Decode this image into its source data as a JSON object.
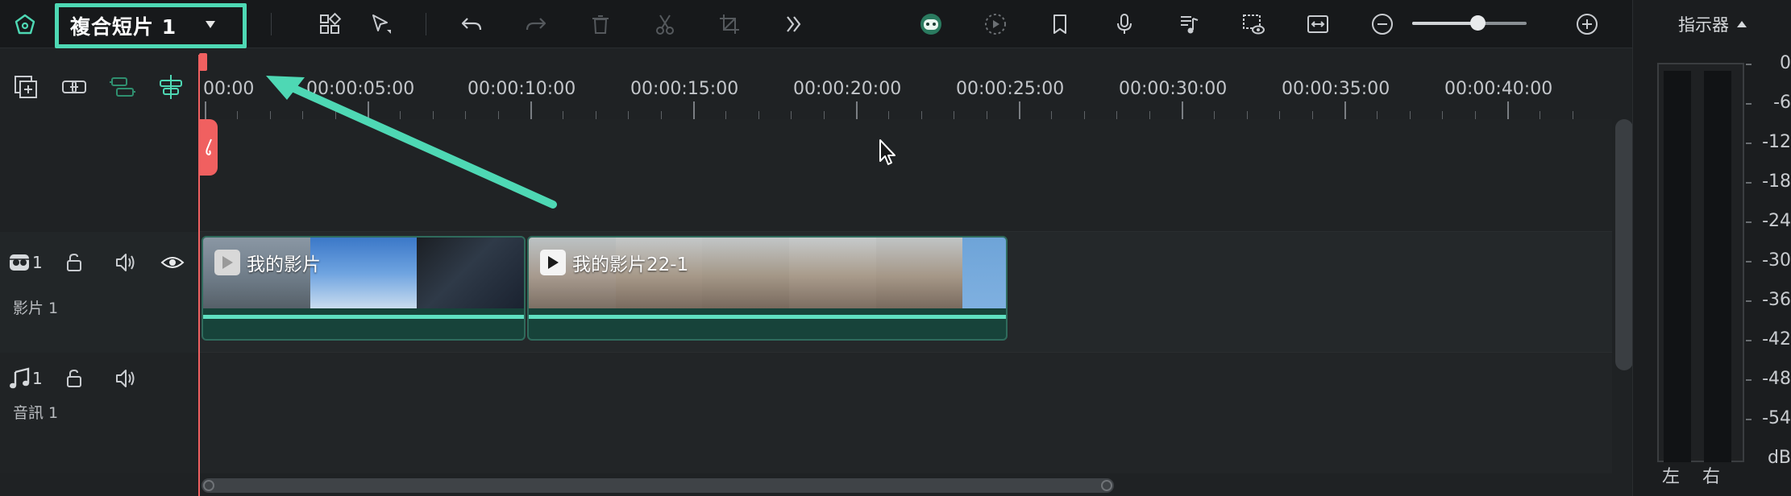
{
  "toolbar": {
    "project_title": "複合短片 1",
    "zoom_level": 0.57,
    "colors": {
      "accent": "#4ed8b4",
      "background": "#17191b"
    },
    "icons": [
      "home-icon",
      "layout-icon",
      "select-tool-icon",
      "undo-icon",
      "redo-icon",
      "delete-icon",
      "cut-icon",
      "crop-icon",
      "more-icon",
      "ai-assistant-icon",
      "render-preview-icon",
      "marker-icon",
      "record-voice-icon",
      "music-icon",
      "preview-eye-icon",
      "fit-icon",
      "zoom-out-icon",
      "zoom-in-icon"
    ]
  },
  "timeline_tools": {
    "icons": [
      "add-track-icon",
      "link-icon",
      "group-icon",
      "snap-icon"
    ]
  },
  "ruler": {
    "labels": [
      "00:00",
      "00:00:05:00",
      "00:00:10:00",
      "00:00:15:00",
      "00:00:20:00",
      "00:00:25:00",
      "00:00:30:00",
      "00:00:35:00",
      "00:00:40:00"
    ]
  },
  "tracks": {
    "video": {
      "number": "1",
      "name": "影片 1",
      "icons": [
        "video-track-icon",
        "lock-icon",
        "volume-icon",
        "eye-icon"
      ]
    },
    "audio": {
      "number": "1",
      "name": "音訊 1",
      "icons": [
        "music-track-icon",
        "lock-icon",
        "volume-icon"
      ]
    }
  },
  "clips": [
    {
      "title": "我的影片"
    },
    {
      "title": "我的影片22-1"
    }
  ],
  "indicator": {
    "title": "指示器",
    "db_labels": [
      "0",
      "-6",
      "-12",
      "-18",
      "-24",
      "-30",
      "-36",
      "-42",
      "-48",
      "-54",
      "dB"
    ],
    "left_label": "左",
    "right_label": "右"
  }
}
